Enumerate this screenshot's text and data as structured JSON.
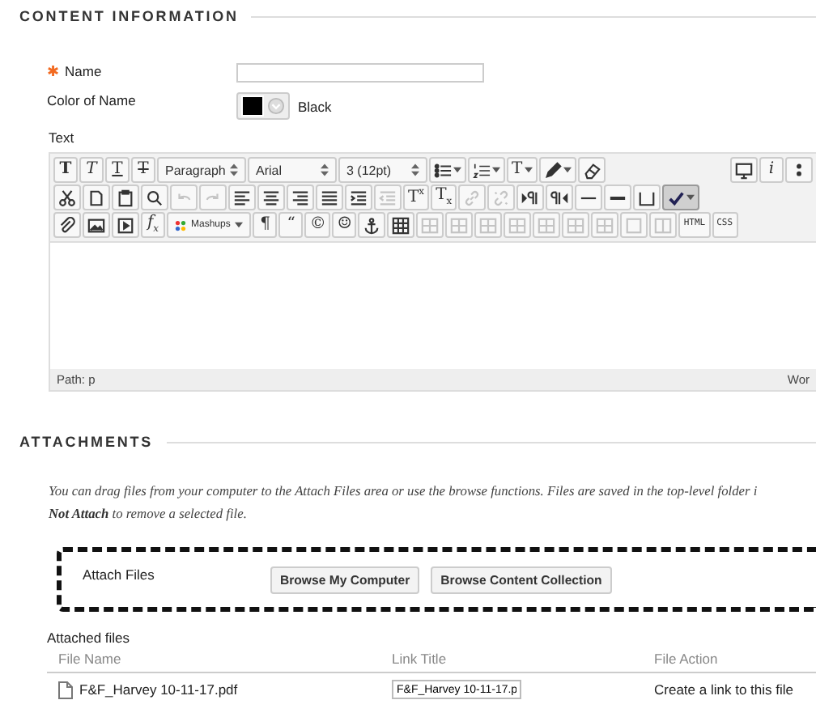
{
  "content_section": {
    "heading": "CONTENT INFORMATION"
  },
  "name_field": {
    "required_mark": "✱",
    "label": "Name"
  },
  "color_field": {
    "label": "Color of Name",
    "color": "#000000",
    "value": "Black"
  },
  "text_label": "Text",
  "editor": {
    "toolbar_rows": [
      [
        {
          "kind": "bold",
          "label": "T",
          "disabled": false,
          "menu": false,
          "on": false
        },
        {
          "kind": "italic",
          "label": "T",
          "disabled": false,
          "menu": false,
          "on": false
        },
        {
          "kind": "underline",
          "label": "T",
          "disabled": false,
          "menu": false,
          "on": false
        },
        {
          "kind": "strike",
          "label": "T",
          "disabled": false,
          "menu": false,
          "on": false
        },
        {
          "kind": "select",
          "label": "Paragraph",
          "disabled": false,
          "menu": false,
          "on": false
        },
        {
          "kind": "select",
          "label": "Arial",
          "disabled": false,
          "menu": false,
          "on": false
        },
        {
          "kind": "select",
          "label": "3 (12pt)",
          "disabled": false,
          "menu": false,
          "on": false
        },
        {
          "kind": "icon",
          "disabled": false,
          "menu": true,
          "on": false
        },
        {
          "kind": "icon",
          "disabled": false,
          "menu": true,
          "on": false
        },
        {
          "kind": "glyph",
          "label": "T",
          "disabled": false,
          "menu": true,
          "on": false
        },
        {
          "kind": "icon",
          "disabled": false,
          "menu": true,
          "on": false
        },
        {
          "kind": "icon",
          "disabled": false,
          "menu": false,
          "on": false
        },
        {
          "kind": "spacer"
        },
        {
          "kind": "icon",
          "disabled": false,
          "menu": false,
          "on": false
        },
        {
          "kind": "italic",
          "label": "i",
          "disabled": false,
          "menu": false,
          "on": false
        },
        {
          "kind": "icon",
          "disabled": false,
          "menu": false,
          "on": false
        }
      ],
      [
        {
          "kind": "icon",
          "disabled": false,
          "menu": false,
          "on": false
        },
        {
          "kind": "icon",
          "disabled": false,
          "menu": false,
          "on": false
        },
        {
          "kind": "icon",
          "disabled": false,
          "menu": false,
          "on": false
        },
        {
          "kind": "icon",
          "disabled": false,
          "menu": false,
          "on": false
        },
        {
          "kind": "icon",
          "disabled": true,
          "menu": false,
          "on": false
        },
        {
          "kind": "icon",
          "disabled": true,
          "menu": false,
          "on": false
        },
        {
          "kind": "icon",
          "disabled": false,
          "menu": false,
          "on": false
        },
        {
          "kind": "icon",
          "disabled": false,
          "menu": false,
          "on": false
        },
        {
          "kind": "icon",
          "disabled": false,
          "menu": false,
          "on": false
        },
        {
          "kind": "icon",
          "disabled": false,
          "menu": false,
          "on": false
        },
        {
          "kind": "icon",
          "disabled": false,
          "menu": false,
          "on": false
        },
        {
          "kind": "icon",
          "disabled": true,
          "menu": false,
          "on": false
        },
        {
          "kind": "glyph",
          "label": "T$^{x}$",
          "disabled": false,
          "menu": false,
          "on": false
        },
        {
          "kind": "glyph",
          "label": "T$_{x}$",
          "disabled": false,
          "menu": false,
          "on": false
        },
        {
          "kind": "icon",
          "disabled": true,
          "menu": false,
          "on": false
        },
        {
          "kind": "icon",
          "disabled": true,
          "menu": false,
          "on": false
        },
        {
          "kind": "icon",
          "disabled": false,
          "menu": false,
          "on": false
        },
        {
          "kind": "icon",
          "disabled": false,
          "menu": false,
          "on": false
        },
        {
          "kind": "icon",
          "disabled": false,
          "menu": false,
          "on": false
        },
        {
          "kind": "icon",
          "disabled": false,
          "menu": false,
          "on": false
        },
        {
          "kind": "icon",
          "disabled": false,
          "menu": false,
          "on": false
        },
        {
          "kind": "icon",
          "disabled": false,
          "menu": true,
          "on": true
        }
      ],
      [
        {
          "kind": "icon",
          "disabled": false,
          "menu": false,
          "on": false
        },
        {
          "kind": "icon",
          "disabled": false,
          "menu": false,
          "on": false
        },
        {
          "kind": "icon",
          "disabled": false,
          "menu": false,
          "on": false
        },
        {
          "kind": "italic",
          "label": "f$_{x}$",
          "disabled": false,
          "menu": false,
          "on": false
        },
        {
          "kind": "select",
          "label": "Mashups",
          "disabled": false,
          "menu": true,
          "on": false
        },
        {
          "kind": "glyph",
          "label": "¶",
          "disabled": false,
          "menu": false,
          "on": false
        },
        {
          "kind": "glyph",
          "label": "“",
          "disabled": false,
          "menu": false,
          "on": false
        },
        {
          "kind": "glyph",
          "label": "©",
          "disabled": false,
          "menu": false,
          "on": false
        },
        {
          "kind": "glyph",
          "label": "☺",
          "disabled": false,
          "menu": false,
          "on": false
        },
        {
          "kind": "icon",
          "disabled": false,
          "menu": false,
          "on": false
        },
        {
          "kind": "icon",
          "disabled": false,
          "menu": false,
          "on": false
        },
        {
          "kind": "icon",
          "disabled": true,
          "menu": false,
          "on": false
        },
        {
          "kind": "icon",
          "disabled": true,
          "menu": false,
          "on": false
        },
        {
          "kind": "icon",
          "disabled": true,
          "menu": false,
          "on": false
        },
        {
          "kind": "icon",
          "disabled": true,
          "menu": false,
          "on": false
        },
        {
          "kind": "icon",
          "disabled": true,
          "menu": false,
          "on": false
        },
        {
          "kind": "icon",
          "disabled": true,
          "menu": false,
          "on": false
        },
        {
          "kind": "icon",
          "disabled": true,
          "menu": false,
          "on": false
        },
        {
          "kind": "icon",
          "disabled": true,
          "menu": false,
          "on": false
        },
        {
          "kind": "icon",
          "disabled": true,
          "menu": false,
          "on": false
        },
        {
          "kind": "code",
          "label": "HTML",
          "disabled": false,
          "menu": false,
          "on": false
        },
        {
          "kind": "code",
          "label": "CSS",
          "disabled": false,
          "menu": false,
          "on": false
        }
      ]
    ],
    "path": "Path: p",
    "word_count": "Wor"
  },
  "attachments_section": {
    "heading": "ATTACHMENTS",
    "instructions": [
      "You can drag files from your computer to the Attach Files area or use the browse functions. Files are saved in the top-level folder i",
      "**Not Attach** to remove a selected file."
    ]
  },
  "attach_files": {
    "label": "Attach Files",
    "buttons": [
      "Browse My Computer",
      "Browse Content Collection"
    ]
  },
  "attached_files": {
    "label": "Attached files",
    "columns": [
      "File Name",
      "Link Title",
      "File Action"
    ],
    "rows": [
      {
        "file_name": "F&F_Harvey 10-11-17.pdf",
        "link_title": "F&F_Harvey 10-11-17.p",
        "file_action": "Create a link to this file"
      }
    ]
  }
}
